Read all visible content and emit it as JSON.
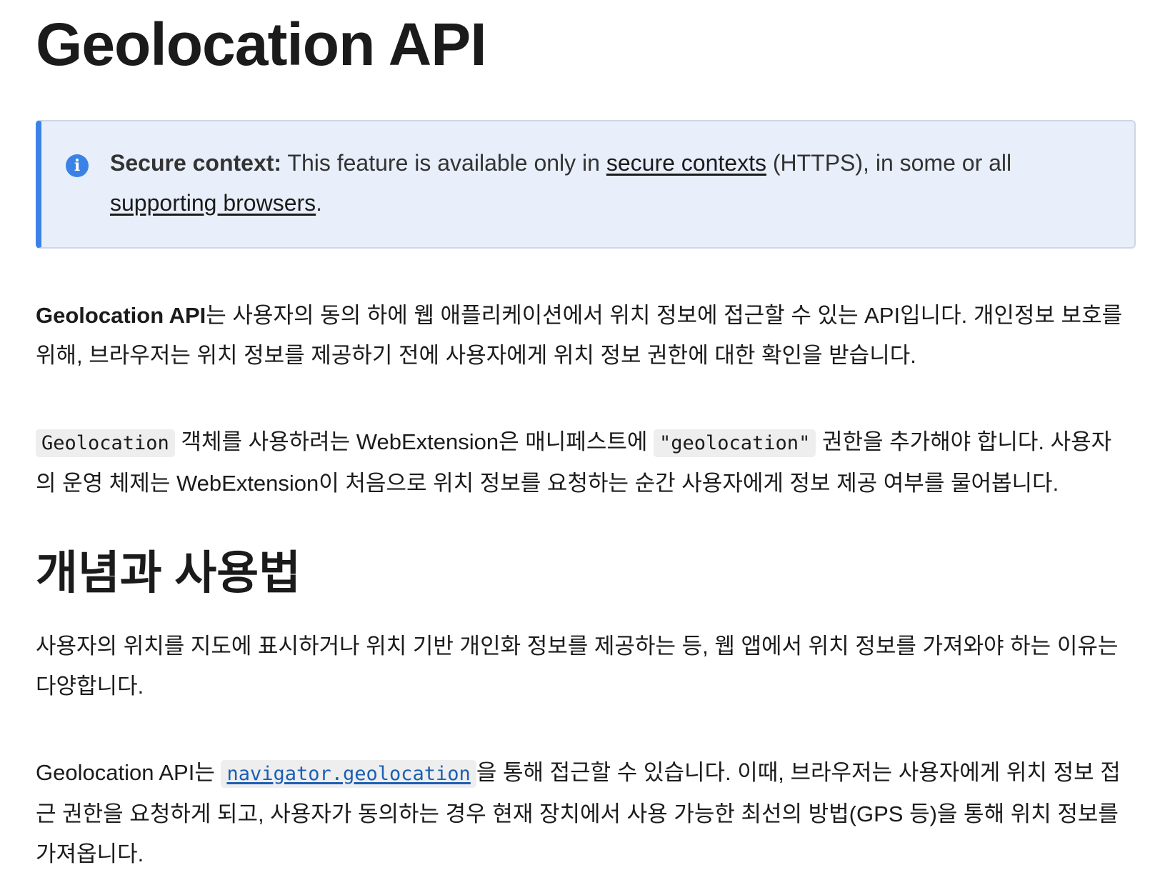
{
  "page": {
    "title": "Geolocation API"
  },
  "notecard": {
    "icon": "info-icon",
    "accent_color": "#3b82e6",
    "background_color": "#e8effa",
    "label": "Secure context:",
    "text_before_link": " This feature is available only in ",
    "link1_text": "secure contexts",
    "text_between": " (HTTPS), in some or all ",
    "link2_text": "supporting browsers",
    "text_after": "."
  },
  "intro": {
    "bold": "Geolocation API",
    "text": "는 사용자의 동의 하에 웹 애플리케이션에서 위치 정보에 접근할 수 있는 API입니다. 개인정보 보호를 위해, 브라우저는 위치 정보를 제공하기 전에 사용자에게 위치 정보 권한에 대한 확인을 받습니다."
  },
  "webext": {
    "code1": "Geolocation",
    "text1": " 객체를 사용하려는 WebExtension은 매니페스트에 ",
    "code2": "\"geolocation\"",
    "text2": " 권한을 추가해야 합니다. 사용자의 운영 체제는 WebExtension이 처음으로 위치 정보를 요청하는 순간 사용자에게 정보 제공 여부를 물어봅니다."
  },
  "section": {
    "heading": "개념과 사용법",
    "para1": "사용자의 위치를 지도에 표시하거나 위치 기반 개인화 정보를 제공하는 등, 웹 앱에서 위치 정보를 가져와야 하는 이유는 다양합니다.",
    "para2_before": "Geolocation API는 ",
    "para2_link": "navigator.geolocation",
    "para2_after": "을 통해 접근할 수 있습니다. 이때, 브라우저는 사용자에게 위치 정보 접근 권한을 요청하게 되고, 사용자가 동의하는 경우 현재 장치에서 사용 가능한 최선의 방법(GPS 등)을 통해 위치 정보를 가져옵니다."
  }
}
